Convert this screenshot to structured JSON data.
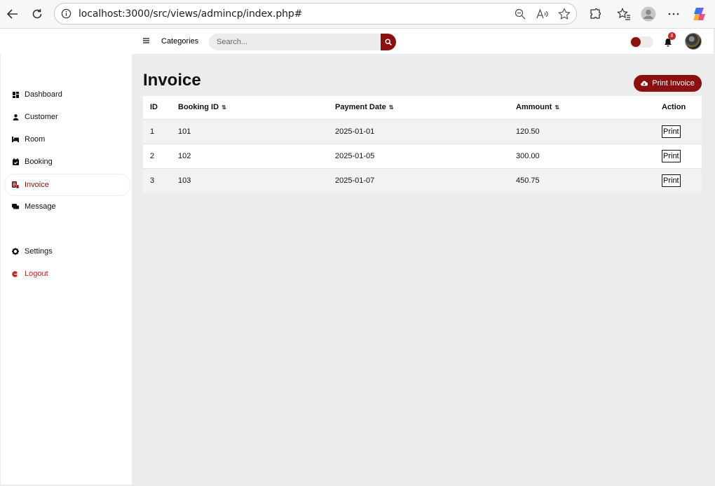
{
  "browser": {
    "url": "localhost:3000/src/views/admincp/index.php#"
  },
  "topbar": {
    "categories_label": "Categories",
    "search_placeholder": "Search...",
    "notification_count": "8"
  },
  "sidebar": {
    "items": [
      {
        "label": "Dashboard",
        "icon": "dashboard-icon"
      },
      {
        "label": "Customer",
        "icon": "user-icon"
      },
      {
        "label": "Room",
        "icon": "bed-icon"
      },
      {
        "label": "Booking",
        "icon": "calendar-icon"
      },
      {
        "label": "Invoice",
        "icon": "invoice-icon",
        "active": true
      },
      {
        "label": "Message",
        "icon": "message-icon"
      }
    ],
    "settings_label": "Settings",
    "logout_label": "Logout"
  },
  "main": {
    "title": "Invoice",
    "print_invoice_label": "Print Invoice",
    "table": {
      "headers": [
        "ID",
        "Booking ID",
        "Payment Date",
        "Ammount",
        "Action"
      ],
      "rows": [
        {
          "id": "1",
          "booking_id": "101",
          "payment_date": "2025-01-01",
          "amount": "120.50",
          "action": "Print"
        },
        {
          "id": "2",
          "booking_id": "102",
          "payment_date": "2025-01-05",
          "amount": "300.00",
          "action": "Print"
        },
        {
          "id": "3",
          "booking_id": "103",
          "payment_date": "2025-01-07",
          "amount": "450.75",
          "action": "Print"
        }
      ]
    }
  },
  "colors": {
    "accent": "#8b1010",
    "logout": "#c62828",
    "background": "#ececec"
  }
}
